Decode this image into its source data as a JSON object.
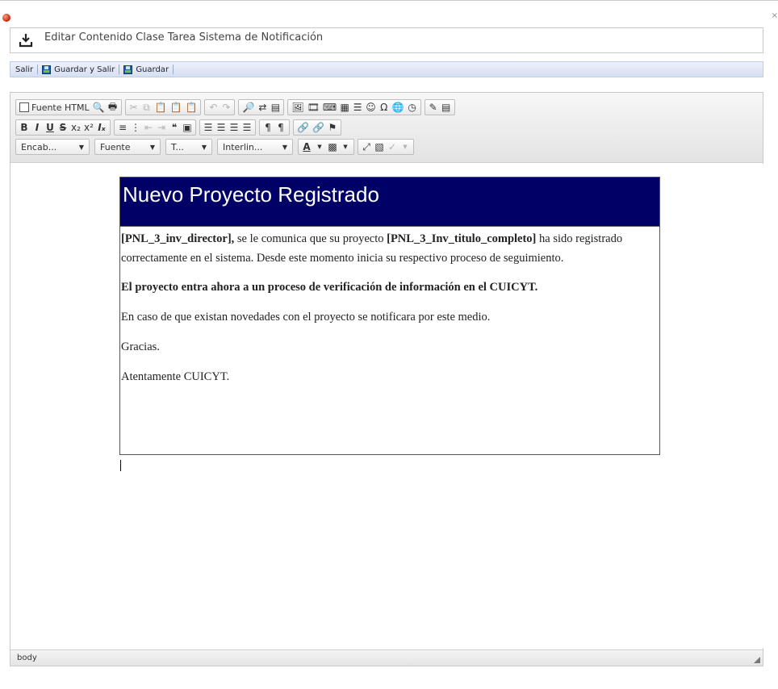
{
  "window": {
    "close_glyph": "×",
    "title": "Editar Contenido Clase Tarea Sistema de Notificación"
  },
  "actions": {
    "exit_label": "Salir",
    "save_exit_label": "Guardar y Salir",
    "save_label": "Guardar"
  },
  "toolbar": {
    "source_label": "Fuente HTML",
    "bold": "B",
    "italic": "I",
    "underline": "U",
    "strike": "S",
    "subscript": "x₂",
    "superscript": "x²",
    "remove_format": "Iₓ",
    "combos": {
      "headings": "Encab...",
      "font": "Fuente",
      "size": "T...",
      "line_height": "Interlin..."
    }
  },
  "document": {
    "header": "Nuevo Proyecto Registrado",
    "p1_var1": "[PNL_3_inv_director],",
    "p1_text1": " se le comunica que su proyecto ",
    "p1_var2": "[PNL_3_Inv_titulo_completo]",
    "p1_text2": " ha sido registrado correctamente en el sistema. Desde este momento inicia su respectivo proceso de seguimiento.",
    "p2": "El proyecto entra ahora a un proceso de verificación de información en el CUICYT.",
    "p3": "En caso de que existan novedades con el proyecto se notificara por este medio.",
    "p4": "Gracias.",
    "p5": "Atentamente CUICYT."
  },
  "statusbar": {
    "path": "body"
  },
  "colors": {
    "header_bg": "#000066",
    "actions_bar": "#d6def2",
    "brand_dot": "#d23a1c"
  }
}
